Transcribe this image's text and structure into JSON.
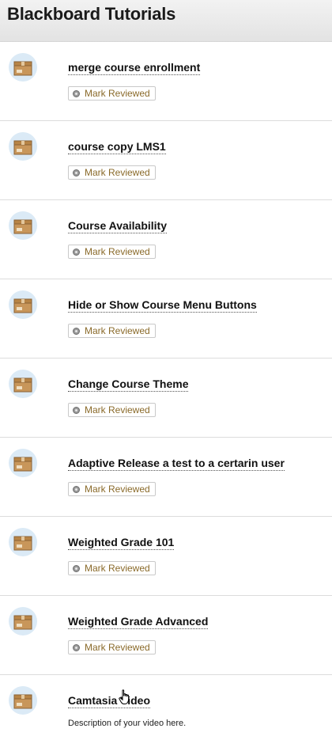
{
  "header": {
    "title": "Blackboard Tutorials"
  },
  "items": [
    {
      "title": "merge course enrollment",
      "button": "Mark Reviewed",
      "icon": "package-icon"
    },
    {
      "title": "course copy LMS1",
      "button": "Mark Reviewed",
      "icon": "package-icon"
    },
    {
      "title": "Course Availability",
      "button": "Mark Reviewed",
      "icon": "package-icon"
    },
    {
      "title": "Hide or Show Course Menu Buttons",
      "button": "Mark Reviewed",
      "icon": "package-icon"
    },
    {
      "title": "Change Course Theme",
      "button": "Mark Reviewed",
      "icon": "package-icon"
    },
    {
      "title": "Adaptive Release a test to a certarin user",
      "button": "Mark Reviewed",
      "icon": "package-icon"
    },
    {
      "title": "Weighted Grade 101",
      "button": "Mark Reviewed",
      "icon": "package-icon"
    },
    {
      "title": "Weighted Grade Advanced",
      "button": "Mark Reviewed",
      "icon": "package-icon"
    },
    {
      "title": "Camtasia Video",
      "description": "Description of your video here.",
      "icon": "package-icon"
    }
  ],
  "colors": {
    "header_bg": "#e8e8e8",
    "icon_circle": "#dbeaf6",
    "button_text": "#8a6a2a"
  }
}
